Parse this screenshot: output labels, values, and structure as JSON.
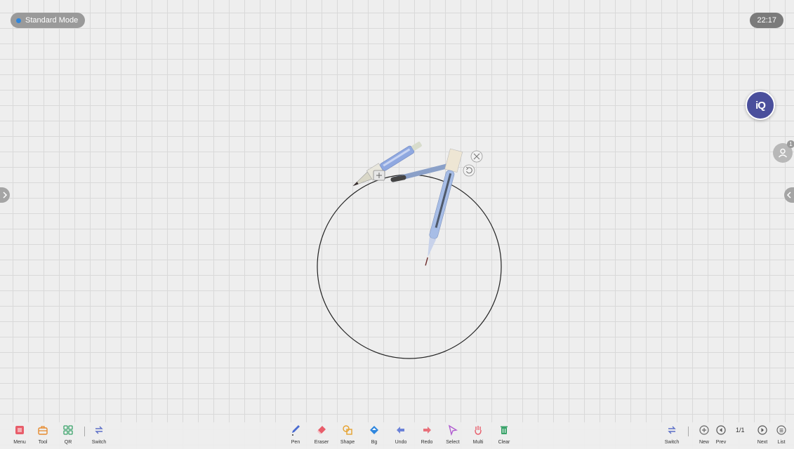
{
  "status": {
    "mode_label": "Standard Mode",
    "clock": "22:17",
    "iq_badge": "iQ",
    "user_count": "1"
  },
  "toolbar": {
    "left": [
      {
        "label": "Menu",
        "icon": "menu-icon"
      },
      {
        "label": "Tool",
        "icon": "toolbox-icon"
      },
      {
        "label": "QR",
        "icon": "qr-icon"
      },
      {
        "label": "Switch",
        "icon": "switch-icon"
      }
    ],
    "center": [
      {
        "label": "Pen",
        "icon": "pen-icon"
      },
      {
        "label": "Eraser",
        "icon": "eraser-icon"
      },
      {
        "label": "Shape",
        "icon": "shape-icon"
      },
      {
        "label": "Bg",
        "icon": "background-fill-icon"
      },
      {
        "label": "Undo",
        "icon": "undo-icon"
      },
      {
        "label": "Redo",
        "icon": "redo-icon"
      },
      {
        "label": "Select",
        "icon": "select-icon"
      },
      {
        "label": "Multi",
        "icon": "multi-touch-icon"
      },
      {
        "label": "Clear",
        "icon": "trash-icon"
      }
    ],
    "right": [
      {
        "label": "Switch",
        "icon": "switch-icon"
      },
      {
        "label": "New",
        "icon": "add-page-icon"
      },
      {
        "label": "Prev",
        "icon": "prev-page-icon"
      },
      {
        "label": "Next",
        "icon": "next-page-icon"
      },
      {
        "label": "List",
        "icon": "page-list-icon"
      }
    ],
    "page_indicator": "1/1"
  },
  "colors": {
    "accent_blue": "#2e86de",
    "iq_badge_bg": "#4a4f9c",
    "canvas_bg": "#eeeeee",
    "grid_line": "#d9d9d9",
    "circle_stroke": "#222222"
  }
}
